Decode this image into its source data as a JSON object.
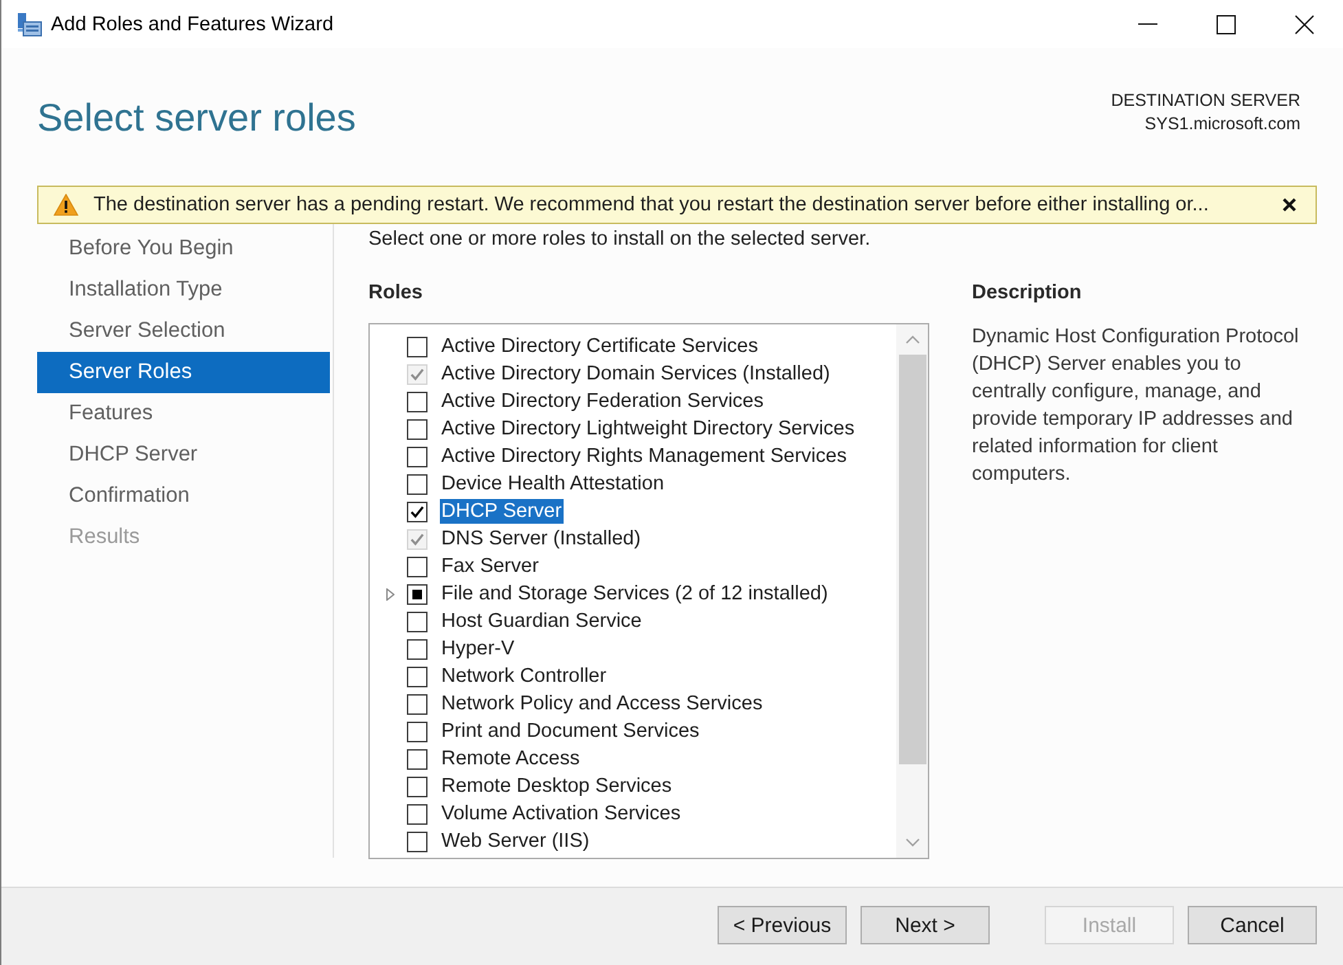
{
  "window": {
    "title": "Add Roles and Features Wizard"
  },
  "header": {
    "title": "Select server roles",
    "destination_label": "DESTINATION SERVER",
    "destination_server": "SYS1.microsoft.com"
  },
  "warning": {
    "message": "The destination server has a pending restart. We recommend that you restart the destination server before either installing or..."
  },
  "sidebar": {
    "items": [
      {
        "label": "Before You Begin",
        "selected": false,
        "disabled": false
      },
      {
        "label": "Installation Type",
        "selected": false,
        "disabled": false
      },
      {
        "label": "Server Selection",
        "selected": false,
        "disabled": false
      },
      {
        "label": "Server Roles",
        "selected": true,
        "disabled": false
      },
      {
        "label": "Features",
        "selected": false,
        "disabled": false
      },
      {
        "label": "DHCP Server",
        "selected": false,
        "disabled": false
      },
      {
        "label": "Confirmation",
        "selected": false,
        "disabled": false
      },
      {
        "label": "Results",
        "selected": false,
        "disabled": true
      }
    ]
  },
  "intro": "Select one or more roles to install on the selected server.",
  "roles": {
    "heading": "Roles",
    "items": [
      {
        "label": "Active Directory Certificate Services",
        "checked": false,
        "partial": false,
        "disabled": false,
        "selected": false
      },
      {
        "label": "Active Directory Domain Services (Installed)",
        "checked": true,
        "partial": false,
        "disabled": true,
        "selected": false
      },
      {
        "label": "Active Directory Federation Services",
        "checked": false,
        "partial": false,
        "disabled": false,
        "selected": false
      },
      {
        "label": "Active Directory Lightweight Directory Services",
        "checked": false,
        "partial": false,
        "disabled": false,
        "selected": false
      },
      {
        "label": "Active Directory Rights Management Services",
        "checked": false,
        "partial": false,
        "disabled": false,
        "selected": false
      },
      {
        "label": "Device Health Attestation",
        "checked": false,
        "partial": false,
        "disabled": false,
        "selected": false
      },
      {
        "label": "DHCP Server",
        "checked": true,
        "partial": false,
        "disabled": false,
        "selected": true
      },
      {
        "label": "DNS Server (Installed)",
        "checked": true,
        "partial": false,
        "disabled": true,
        "selected": false
      },
      {
        "label": "Fax Server",
        "checked": false,
        "partial": false,
        "disabled": false,
        "selected": false
      },
      {
        "label": "File and Storage Services (2 of 12 installed)",
        "checked": false,
        "partial": true,
        "disabled": false,
        "selected": false,
        "expanded": false
      },
      {
        "label": "Host Guardian Service",
        "checked": false,
        "partial": false,
        "disabled": false,
        "selected": false
      },
      {
        "label": "Hyper-V",
        "checked": false,
        "partial": false,
        "disabled": false,
        "selected": false
      },
      {
        "label": "Network Controller",
        "checked": false,
        "partial": false,
        "disabled": false,
        "selected": false
      },
      {
        "label": "Network Policy and Access Services",
        "checked": false,
        "partial": false,
        "disabled": false,
        "selected": false
      },
      {
        "label": "Print and Document Services",
        "checked": false,
        "partial": false,
        "disabled": false,
        "selected": false
      },
      {
        "label": "Remote Access",
        "checked": false,
        "partial": false,
        "disabled": false,
        "selected": false
      },
      {
        "label": "Remote Desktop Services",
        "checked": false,
        "partial": false,
        "disabled": false,
        "selected": false
      },
      {
        "label": "Volume Activation Services",
        "checked": false,
        "partial": false,
        "disabled": false,
        "selected": false
      },
      {
        "label": "Web Server (IIS)",
        "checked": false,
        "partial": false,
        "disabled": false,
        "selected": false
      }
    ]
  },
  "description": {
    "heading": "Description",
    "text": "Dynamic Host Configuration Protocol (DHCP) Server enables you to centrally configure, manage, and provide temporary IP addresses and related information for client computers."
  },
  "navigation_buttons": [
    {
      "label": "< Previous",
      "disabled": false
    },
    {
      "label": "Next >",
      "disabled": false
    }
  ],
  "action_buttons": [
    {
      "label": "Install",
      "disabled": true
    },
    {
      "label": "Cancel",
      "disabled": false
    }
  ]
}
